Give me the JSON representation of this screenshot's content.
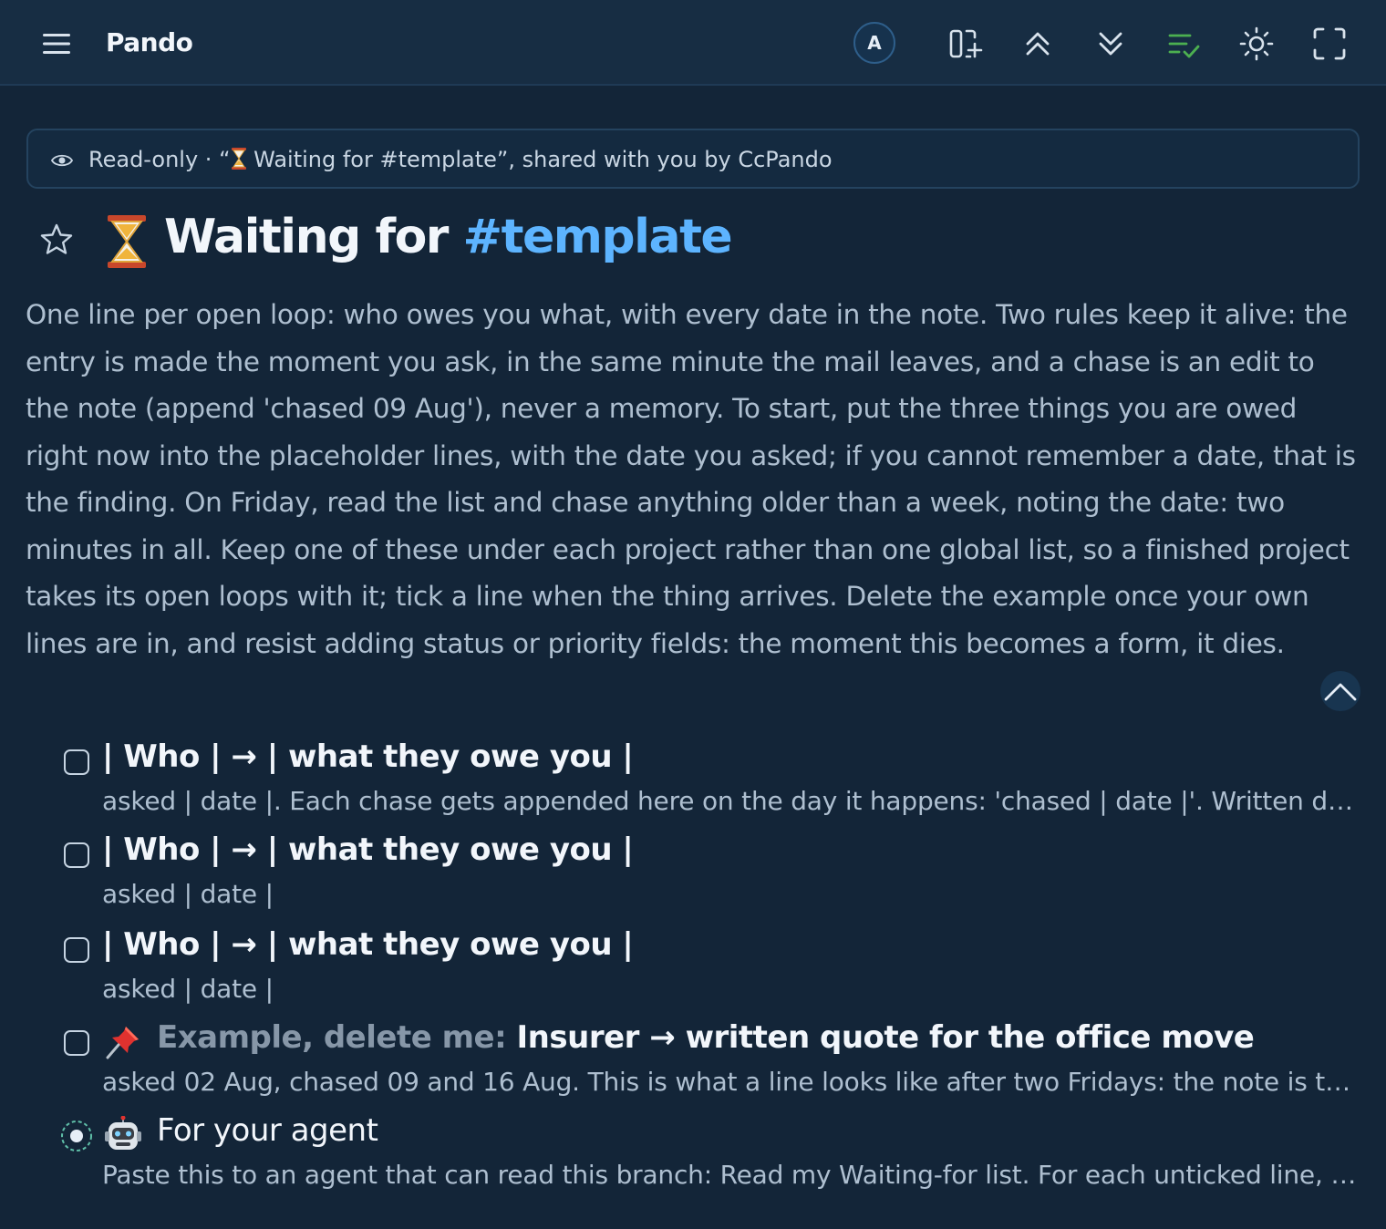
{
  "app": {
    "title": "Pando"
  },
  "header": {
    "avatar_initial": "A",
    "icons": [
      "add-panel-icon",
      "collapse-all-icon",
      "expand-all-icon",
      "checklist-icon",
      "theme-icon",
      "fullscreen-icon"
    ]
  },
  "banner": {
    "text_prefix": "Read-only · “",
    "text_suffix": " Waiting for #template”, shared with you by CcPando"
  },
  "page": {
    "title_main": "Waiting for ",
    "title_tag": "#template",
    "description": "One line per open loop: who owes you what, with every date in the note. Two rules keep it alive: the entry is made the moment you ask, in the same minute the mail leaves, and a chase is an edit to the note (append 'chased 09 Aug'), never a memory. To start, put the three things you are owed right now into the placeholder lines, with the date you asked; if you cannot remember a date, that is the finding. On Friday, read the list and chase anything older than a week, noting the date: two minutes in all. Keep one of these under each project rather than one global list, so a finished project takes its open loops with it; tick a line when the thing arrives. Delete the example once your own lines are in, and resist adding status or priority fields: the moment this becomes a form, it dies."
  },
  "items": [
    {
      "title": "| Who | → | what they owe you |",
      "subtitle": "asked | date |. Each chase gets appended here on the day it happens: 'chased | date |'. Written dates make Friday's review a two-minute read."
    },
    {
      "title": "| Who | → | what they owe you |",
      "subtitle": "asked | date |"
    },
    {
      "title": "| Who | → | what they owe you |",
      "subtitle": "asked | date |"
    },
    {
      "prefix": "Example, delete me: ",
      "title": "Insurer → written quote for the office move",
      "subtitle": "asked 02 Aug, chased 09 and 16 Aug. This is what a line looks like after two Fridays: the note is the history."
    },
    {
      "title": "For your agent",
      "subtitle": "Paste this to an agent that can read this branch: Read my Waiting-for list. For each unticked line, work out how long it has been open."
    }
  ],
  "colors": {
    "background": "#132538",
    "topbar": "#172d43",
    "accent_tag": "#5db4ff",
    "checklist_icon": "#4caf50"
  }
}
